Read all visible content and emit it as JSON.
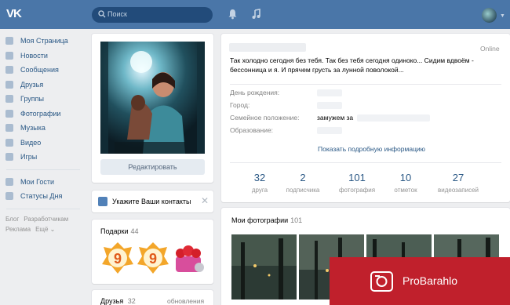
{
  "header": {
    "logo": "VK",
    "search_placeholder": "Поиск"
  },
  "sidebar": {
    "items": [
      {
        "label": "Моя Страница",
        "icon": "home-icon"
      },
      {
        "label": "Новости",
        "icon": "news-icon"
      },
      {
        "label": "Сообщения",
        "icon": "message-icon"
      },
      {
        "label": "Друзья",
        "icon": "friends-icon"
      },
      {
        "label": "Группы",
        "icon": "groups-icon"
      },
      {
        "label": "Фотографии",
        "icon": "camera-icon"
      },
      {
        "label": "Музыка",
        "icon": "music-icon"
      },
      {
        "label": "Видео",
        "icon": "video-icon"
      },
      {
        "label": "Игры",
        "icon": "games-icon"
      }
    ],
    "apps": [
      {
        "label": "Мои Гости",
        "icon": "app-icon"
      },
      {
        "label": "Статусы Дня",
        "icon": "app-icon"
      }
    ],
    "footer": {
      "blog": "Блог",
      "developers": "Разработчикам",
      "ads": "Реклама",
      "more": "Ещё ⌄"
    }
  },
  "photo_block": {
    "edit_label": "Редактировать"
  },
  "contacts": {
    "label": "Укажите Ваши контакты",
    "close": "✕"
  },
  "gifts": {
    "title": "Подарки",
    "count": "44"
  },
  "friends": {
    "title": "Друзья",
    "count": "32",
    "updates": "обновления"
  },
  "profile": {
    "online": "Online",
    "status": "Так холодно сегодня без тебя. Так без тебя сегодня одиноко... Сидим вдвоём - бессонница и я. И прячем грусть за лунной поволокой...",
    "birthday_label": "День рождения:",
    "city_label": "Город:",
    "family_label": "Семейное положение:",
    "family_value": "замужем за",
    "education_label": "Образование:",
    "more_link": "Показать подробную информацию"
  },
  "counters": [
    {
      "num": "32",
      "label": "друга"
    },
    {
      "num": "2",
      "label": "подписчика"
    },
    {
      "num": "101",
      "label": "фотография"
    },
    {
      "num": "10",
      "label": "отметок"
    },
    {
      "num": "27",
      "label": "видеозаписей"
    }
  ],
  "photos": {
    "title": "Мои фотографии",
    "count": "101"
  },
  "watermark": {
    "text": "ProBarahlo"
  },
  "colors": {
    "header": "#4a76a8",
    "link": "#2a5885",
    "background": "#edeef0",
    "watermark": "#c0202c"
  }
}
